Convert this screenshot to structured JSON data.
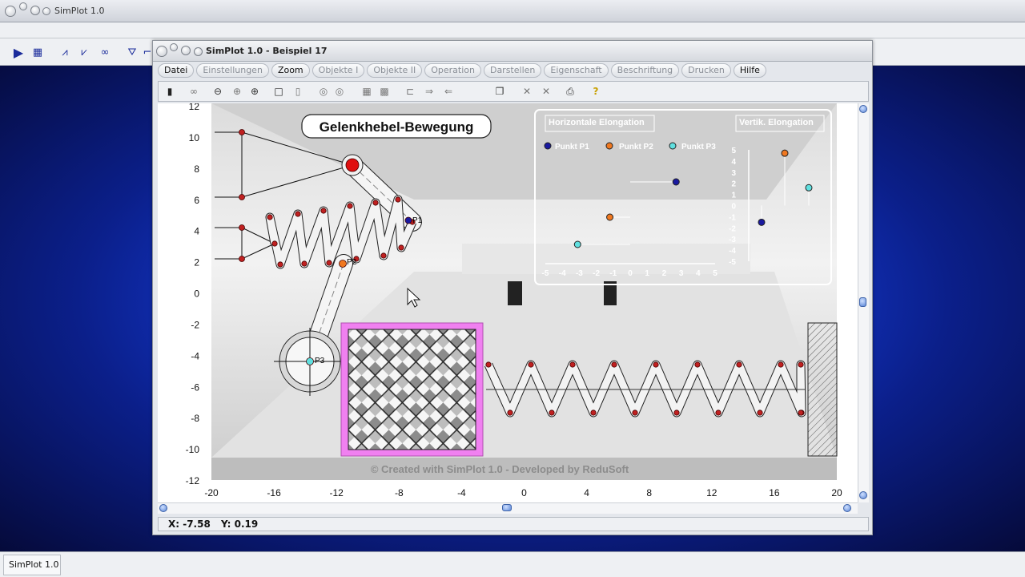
{
  "outer": {
    "title": "SimPlot 1.0",
    "taskbar_label": "SimPlot 1.0"
  },
  "window": {
    "title": "SimPlot 1.0 - Beispiel 17",
    "menu": [
      {
        "label": "Datei",
        "enabled": true
      },
      {
        "label": "Einstellungen",
        "enabled": false
      },
      {
        "label": "Zoom",
        "enabled": true
      },
      {
        "label": "Objekte I",
        "enabled": false
      },
      {
        "label": "Objekte II",
        "enabled": false
      },
      {
        "label": "Operation",
        "enabled": false
      },
      {
        "label": "Darstellen",
        "enabled": false
      },
      {
        "label": "Eigenschaft",
        "enabled": false
      },
      {
        "label": "Beschriftung",
        "enabled": false
      },
      {
        "label": "Drucken",
        "enabled": false
      },
      {
        "label": "Hilfe",
        "enabled": true
      }
    ]
  },
  "plot": {
    "y_ticks": [
      "12",
      "10",
      "8",
      "6",
      "4",
      "2",
      "0",
      "-2",
      "-4",
      "-6",
      "-8",
      "-10",
      "-12"
    ],
    "x_ticks": [
      "-20",
      "-16",
      "-12",
      "-8",
      "-4",
      "0",
      "4",
      "8",
      "12",
      "16",
      "20"
    ],
    "title": "Gelenkhebel-Bewegung",
    "footer": "© Created with SimPlot 1.0 - Developed by ReduSoft",
    "point_labels": {
      "p1": "P1",
      "p2": "P2",
      "p3": "P3"
    },
    "inset": {
      "h_title": "Horizontale Elongation",
      "v_title": "Vertik. Elongation",
      "legend": [
        {
          "label": "Punkt P1",
          "color": "#1a1aa0"
        },
        {
          "label": "Punkt P2",
          "color": "#f07820"
        },
        {
          "label": "Punkt P3",
          "color": "#60e0e0"
        }
      ],
      "h_ticks": [
        "-5",
        "-4",
        "-3",
        "-2",
        "-1",
        "0",
        "1",
        "2",
        "3",
        "4",
        "5"
      ],
      "v_ticks": [
        "5",
        "4",
        "3",
        "2",
        "1",
        "0",
        "-1",
        "-2",
        "-3",
        "-4",
        "-5"
      ],
      "h_values": {
        "p1": 2.7,
        "p2": -1.2,
        "p3": -3.1
      },
      "v_values": {
        "p1": -1.5,
        "p2": 4.7,
        "p3": 1.6
      }
    }
  },
  "status": {
    "x": "X: -7.58",
    "y": "Y: 0.19"
  }
}
